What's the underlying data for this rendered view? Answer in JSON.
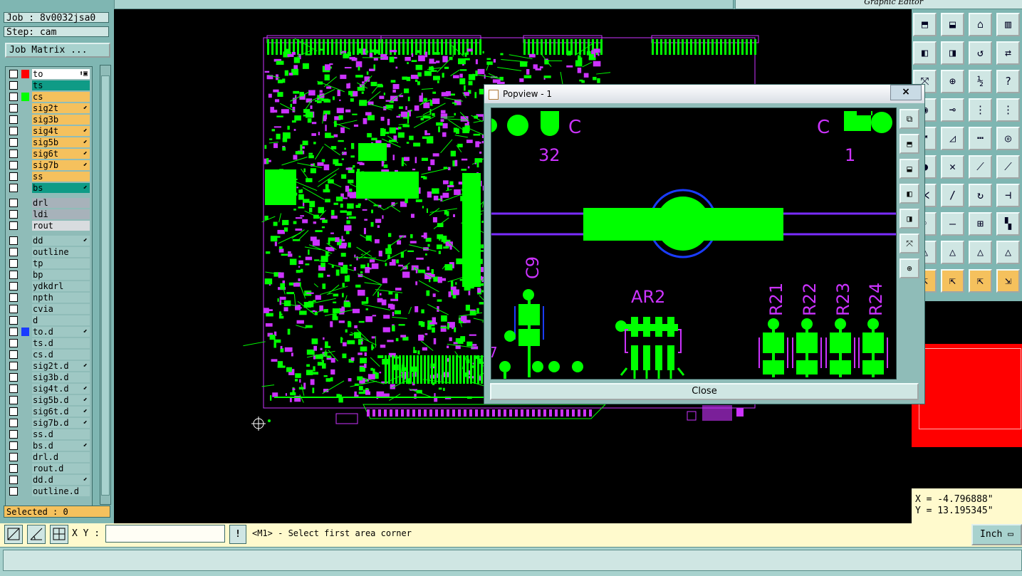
{
  "app": {
    "title_right": "Graphic Editor"
  },
  "job": {
    "job_line": "Job : 8v0032jsa0",
    "step_line": "Step: cam",
    "matrix_button": "Job Matrix ..."
  },
  "layers": [
    {
      "name": "to",
      "color": "#ffffff",
      "swatch": "#ff0000",
      "mark": "⬆▣"
    },
    {
      "name": "ts",
      "color": "#0f9b86",
      "swatch": "",
      "mark": ""
    },
    {
      "name": "cs",
      "color": "#f5c15d",
      "swatch": "#00ff00",
      "mark": ""
    },
    {
      "name": "sig2t",
      "color": "#f5c15d",
      "swatch": "",
      "mark": "⬋"
    },
    {
      "name": "sig3b",
      "color": "#f5c15d",
      "swatch": "",
      "mark": ""
    },
    {
      "name": "sig4t",
      "color": "#f5c15d",
      "swatch": "",
      "mark": "⬋"
    },
    {
      "name": "sig5b",
      "color": "#f5c15d",
      "swatch": "",
      "mark": "⬋"
    },
    {
      "name": "sig6t",
      "color": "#f5c15d",
      "swatch": "",
      "mark": "⬋"
    },
    {
      "name": "sig7b",
      "color": "#f5c15d",
      "swatch": "",
      "mark": "⬋"
    },
    {
      "name": "ss",
      "color": "#f5c15d",
      "swatch": "",
      "mark": ""
    },
    {
      "name": "bs",
      "color": "#0f9b86",
      "swatch": "",
      "mark": "⬋"
    },
    {
      "name": "drl",
      "color": "#a7b2ba",
      "swatch": "",
      "mark": ""
    },
    {
      "name": "ldi",
      "color": "#a7b2ba",
      "swatch": "",
      "mark": ""
    },
    {
      "name": "rout",
      "color": "#d8dcdf",
      "swatch": "",
      "mark": ""
    },
    {
      "name": "dd",
      "color": "#9fc8c4",
      "swatch": "",
      "mark": "⬋"
    },
    {
      "name": "outline",
      "color": "#9fc8c4",
      "swatch": "",
      "mark": ""
    },
    {
      "name": "tp",
      "color": "#9fc8c4",
      "swatch": "",
      "mark": ""
    },
    {
      "name": "bp",
      "color": "#9fc8c4",
      "swatch": "",
      "mark": ""
    },
    {
      "name": "ydkdrl",
      "color": "#9fc8c4",
      "swatch": "",
      "mark": ""
    },
    {
      "name": "npth",
      "color": "#9fc8c4",
      "swatch": "",
      "mark": ""
    },
    {
      "name": "cvia",
      "color": "#9fc8c4",
      "swatch": "",
      "mark": ""
    },
    {
      "name": "d",
      "color": "#9fc8c4",
      "swatch": "",
      "mark": ""
    },
    {
      "name": "to.d",
      "color": "#9fc8c4",
      "swatch": "#1a3cff",
      "mark": "⬋"
    },
    {
      "name": "ts.d",
      "color": "#9fc8c4",
      "swatch": "",
      "mark": ""
    },
    {
      "name": "cs.d",
      "color": "#9fc8c4",
      "swatch": "",
      "mark": ""
    },
    {
      "name": "sig2t.d",
      "color": "#9fc8c4",
      "swatch": "",
      "mark": "⬋"
    },
    {
      "name": "sig3b.d",
      "color": "#9fc8c4",
      "swatch": "",
      "mark": ""
    },
    {
      "name": "sig4t.d",
      "color": "#9fc8c4",
      "swatch": "",
      "mark": "⬋"
    },
    {
      "name": "sig5b.d",
      "color": "#9fc8c4",
      "swatch": "",
      "mark": "⬋"
    },
    {
      "name": "sig6t.d",
      "color": "#9fc8c4",
      "swatch": "",
      "mark": "⬋"
    },
    {
      "name": "sig7b.d",
      "color": "#9fc8c4",
      "swatch": "",
      "mark": "⬋"
    },
    {
      "name": "ss.d",
      "color": "#9fc8c4",
      "swatch": "",
      "mark": ""
    },
    {
      "name": "bs.d",
      "color": "#9fc8c4",
      "swatch": "",
      "mark": "⬋"
    },
    {
      "name": "drl.d",
      "color": "#9fc8c4",
      "swatch": "",
      "mark": ""
    },
    {
      "name": "rout.d",
      "color": "#9fc8c4",
      "swatch": "",
      "mark": ""
    },
    {
      "name": "dd.d",
      "color": "#9fc8c4",
      "swatch": "",
      "mark": "⬋"
    },
    {
      "name": "outline.d",
      "color": "#9fc8c4",
      "swatch": "",
      "mark": ""
    }
  ],
  "selected": "Selected : 0",
  "bottom": {
    "xy_label": "X Y :",
    "xy_value": "",
    "excl": "!",
    "prompt": "<M1> - Select first area corner",
    "unit": "Inch"
  },
  "coords": {
    "x": "X = -4.796888\"",
    "y": "Y = 13.195345\""
  },
  "popview": {
    "title": "Popview - 1",
    "close_x": "×",
    "close_button": "Close",
    "labels": {
      "c_left": "C",
      "c_right": "C",
      "n32": "32",
      "n1": "1",
      "c9": "C9",
      "ar2": "AR2",
      "r21": "R21",
      "r22": "R22",
      "r23": "R23",
      "r24": "R24",
      "n7": "7"
    }
  },
  "colors": {
    "copper": "#00ff00",
    "silk": "#cc33ff",
    "blue": "#1a3cff",
    "panel": "#7fb6b2"
  }
}
